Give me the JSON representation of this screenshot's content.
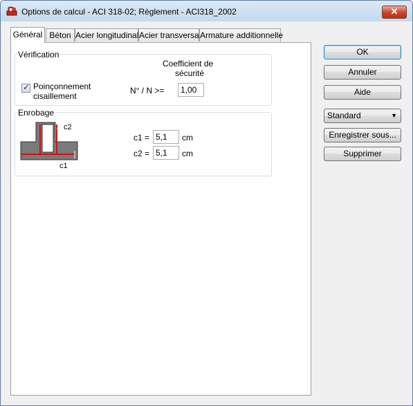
{
  "window": {
    "title": "Options de calcul - ACI 318-02;  Règlement - ACI318_2002",
    "close_glyph": "✕"
  },
  "tabs": [
    {
      "label": "Général",
      "active": true
    },
    {
      "label": "Béton"
    },
    {
      "label": "Acier longitudinal"
    },
    {
      "label": "Acier transversal"
    },
    {
      "label": "Armature additionnelle"
    }
  ],
  "verification": {
    "group_label": "Vérification",
    "coef_header_line1": "Coefficient de",
    "coef_header_line2": "sécurité",
    "checkbox_label_line1": "Poinçonnement",
    "checkbox_label_line2": "cisaillement",
    "checkbox_checked": true,
    "check_glyph": "✓",
    "ratio_label": "N° / N  >=",
    "ratio_value": "1,00"
  },
  "enrobage": {
    "group_label": "Enrobage",
    "diagram_c1": "c1",
    "diagram_c2": "c2",
    "c1_label": "c1 =",
    "c1_value": "5,1",
    "c1_unit": "cm",
    "c2_label": "c2 =",
    "c2_value": "5,1",
    "c2_unit": "cm"
  },
  "buttons": {
    "ok": "OK",
    "cancel": "Annuler",
    "help": "Aide",
    "preset_value": "Standard",
    "save_as": "Enregistrer sous...",
    "delete": "Supprimer"
  },
  "colors": {
    "rebar": "#d01010",
    "concrete": "#7a7a7a"
  }
}
